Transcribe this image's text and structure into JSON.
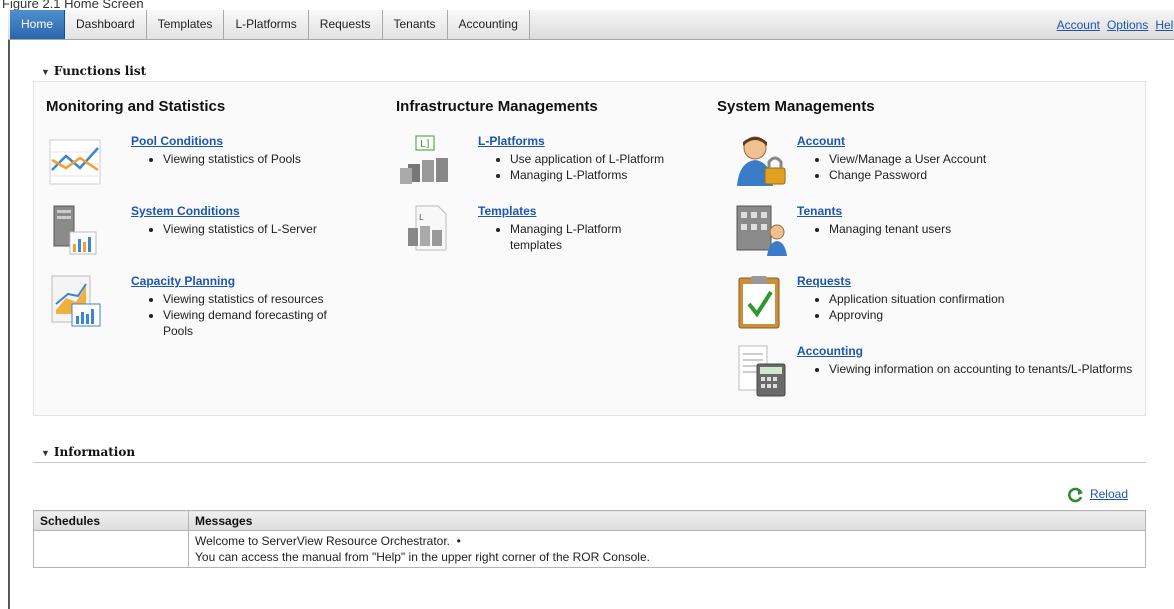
{
  "caption": "Figure 2.1 Home Screen",
  "nav": {
    "tabs": [
      {
        "label": "Home"
      },
      {
        "label": "Dashboard"
      },
      {
        "label": "Templates"
      },
      {
        "label": "L-Platforms"
      },
      {
        "label": "Requests"
      },
      {
        "label": "Tenants"
      },
      {
        "label": "Accounting"
      }
    ],
    "links": [
      "Account",
      "Options",
      "Help"
    ]
  },
  "functions": {
    "header": "Functions list",
    "columns": [
      {
        "title": "Monitoring and Statistics",
        "items": [
          {
            "title": "Pool Conditions",
            "icon": "line-chart-icon",
            "bullets": [
              "Viewing statistics of Pools"
            ]
          },
          {
            "title": "System Conditions",
            "icon": "server-chart-icon",
            "bullets": [
              "Viewing statistics of L-Server"
            ]
          },
          {
            "title": "Capacity Planning",
            "icon": "capacity-chart-icon",
            "bullets": [
              "Viewing statistics of resources",
              "Viewing demand forecasting of Pools"
            ]
          }
        ]
      },
      {
        "title": "Infrastructure Managements",
        "items": [
          {
            "title": "L-Platforms",
            "icon": "servers-icon",
            "bullets": [
              "Use application of L-Platform",
              "Managing L-Platforms"
            ]
          },
          {
            "title": "Templates",
            "icon": "template-icon",
            "bullets": [
              "Managing L-Platform templates"
            ]
          }
        ]
      },
      {
        "title": "System Managements",
        "items": [
          {
            "title": "Account",
            "icon": "user-lock-icon",
            "bullets": [
              "View/Manage a User Account",
              "Change Password"
            ]
          },
          {
            "title": "Tenants",
            "icon": "building-user-icon",
            "bullets": [
              "Managing tenant users"
            ]
          },
          {
            "title": "Requests",
            "icon": "clipboard-check-icon",
            "bullets": [
              "Application situation confirmation",
              "Approving"
            ]
          },
          {
            "title": "Accounting",
            "icon": "calculator-icon",
            "bullets": [
              "Viewing information on accounting to tenants/L-Platforms"
            ]
          }
        ]
      }
    ]
  },
  "information": {
    "header": "Information",
    "reload_label": "Reload",
    "columns": [
      "Schedules",
      "Messages"
    ],
    "rows": [
      {
        "schedule": "",
        "messages": [
          "Welcome to ServerView Resource Orchestrator.  •",
          "You can access the manual from \"Help\" in the upper right corner of the ROR Console."
        ]
      }
    ]
  },
  "colors": {
    "active_tab": "#3a78bf",
    "link": "#1d56b0",
    "reload_icon": "#2e8b2e"
  }
}
